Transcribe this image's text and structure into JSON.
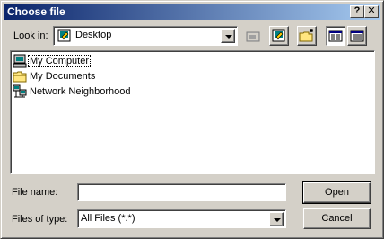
{
  "window": {
    "title": "Choose file",
    "help_label": "?",
    "close_label": "✕"
  },
  "look_in": {
    "label": "Look in:",
    "value": "Desktop"
  },
  "toolbar": {
    "up_icon": "up-folder-icon",
    "desktop_icon": "desktop-icon",
    "new_folder_icon": "new-folder-icon",
    "list_icon": "list-view-icon",
    "details_icon": "details-view-icon"
  },
  "files": [
    {
      "name": "My Computer",
      "icon": "computer-icon"
    },
    {
      "name": "My Documents",
      "icon": "folder-icon"
    },
    {
      "name": "Network Neighborhood",
      "icon": "network-icon"
    }
  ],
  "file_name": {
    "label": "File name:",
    "value": ""
  },
  "file_type": {
    "label": "Files of type:",
    "value": "All Files (*.*)"
  },
  "buttons": {
    "open": "Open",
    "cancel": "Cancel"
  }
}
